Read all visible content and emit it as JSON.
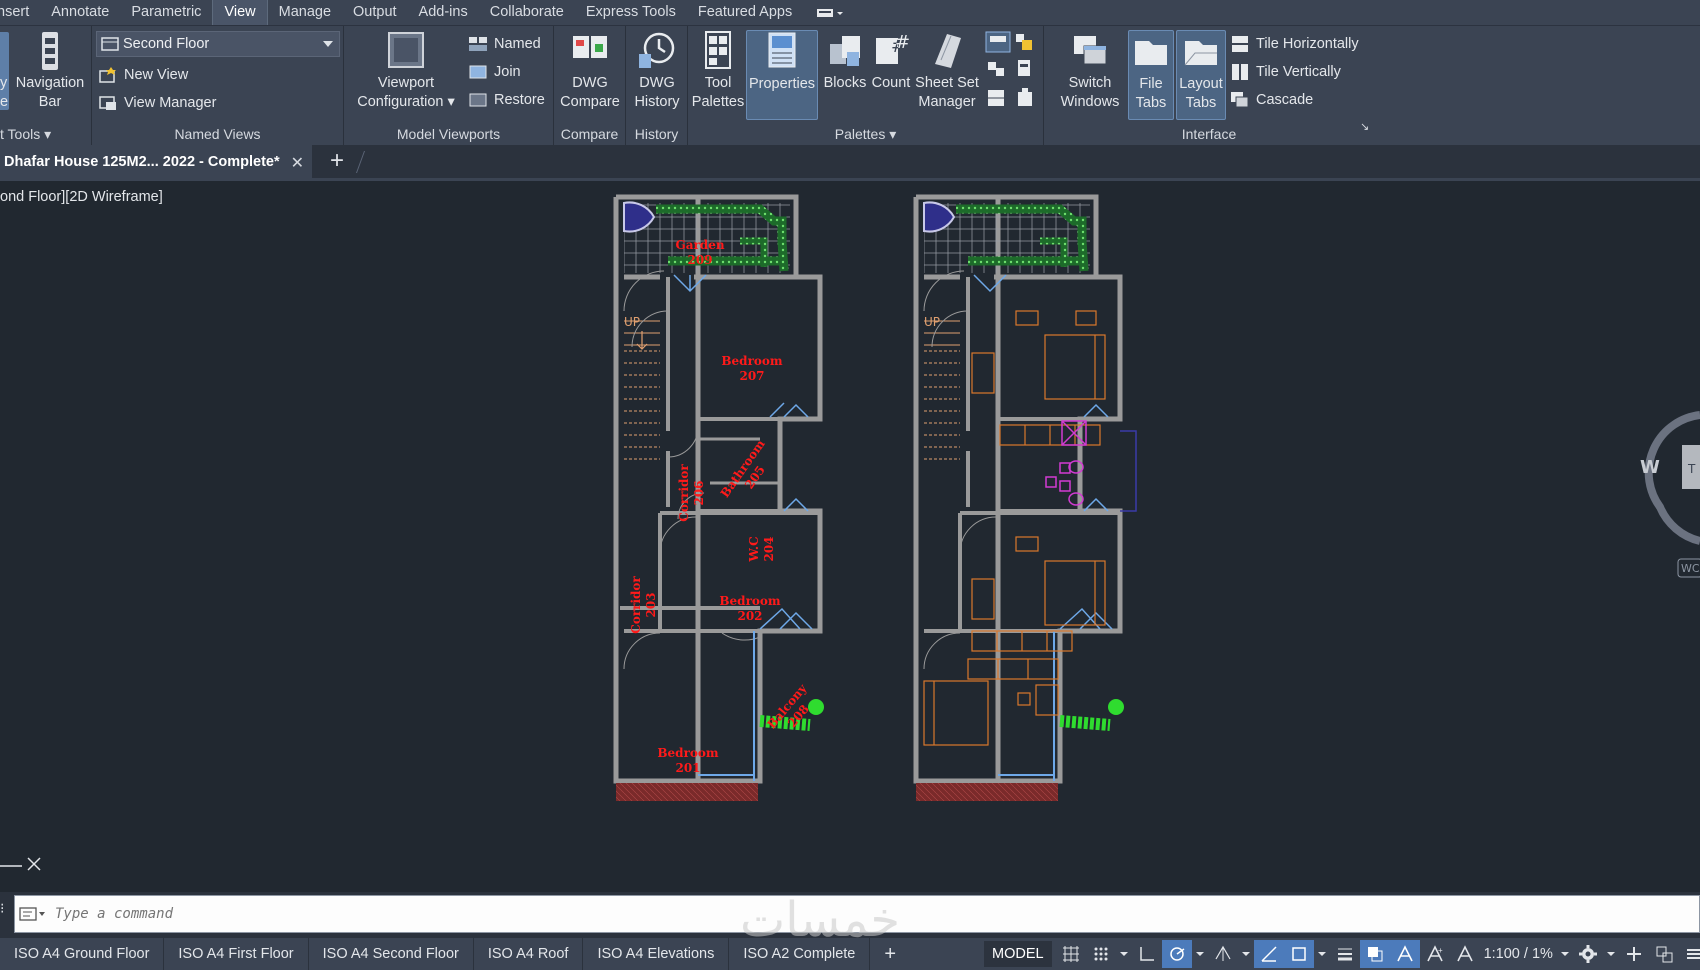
{
  "menu": {
    "items": [
      "Insert",
      "Annotate",
      "Parametric",
      "View",
      "Manage",
      "Output",
      "Add-ins",
      "Collaborate",
      "Express Tools",
      "Featured Apps"
    ],
    "active": "View"
  },
  "ribbon": {
    "navigation_bar": "Navigation Bar",
    "navigation_bar_line1": "Navigation",
    "navigation_bar_line2": "Bar",
    "left_cut_top": "y",
    "left_cut_bottom": "e",
    "viewport_tools_label": "t Tools",
    "named_views": {
      "dropdown_value": "Second Floor",
      "new_view": "New View",
      "view_manager": "View Manager",
      "label": "Named Views"
    },
    "model_viewports": {
      "viewport_configuration_line1": "Viewport",
      "viewport_configuration_line2": "Configuration",
      "named": "Named",
      "join": "Join",
      "restore": "Restore",
      "label": "Model Viewports"
    },
    "compare": {
      "dwg_compare_line1": "DWG",
      "dwg_compare_line2": "Compare",
      "label": "Compare"
    },
    "history": {
      "dwg_history_line1": "DWG",
      "dwg_history_line2": "History",
      "label": "History"
    },
    "palettes": {
      "tool_palettes_line1": "Tool",
      "tool_palettes_line2": "Palettes",
      "properties": "Properties",
      "blocks": "Blocks",
      "count": "Count",
      "sheet_set_manager_line1": "Sheet Set",
      "sheet_set_manager_line2": "Manager",
      "label": "Palettes"
    },
    "interface": {
      "switch_windows_line1": "Switch",
      "switch_windows_line2": "Windows",
      "file_tabs_line1": "File",
      "file_tabs_line2": "Tabs",
      "layout_tabs_line1": "Layout",
      "layout_tabs_line2": "Tabs",
      "tile_horizontally": "Tile Horizontally",
      "tile_vertically": "Tile Vertically",
      "cascade": "Cascade",
      "label": "Interface"
    }
  },
  "tabs": {
    "document": "Dhafar House 125M2... 2022 - Complete*",
    "close": "✕",
    "add": "+"
  },
  "viewport": {
    "label": "ond Floor][2D Wireframe]",
    "compass_w": "W",
    "compass_t": "T",
    "wcs": "WC"
  },
  "plan": {
    "rooms": [
      {
        "name": "Garden",
        "num": "209"
      },
      {
        "name": "Bedroom",
        "num": "207"
      },
      {
        "name": "Corridor",
        "num": "206"
      },
      {
        "name": "Bathroom",
        "num": "205"
      },
      {
        "name": "W.C",
        "num": "204"
      },
      {
        "name": "Corridor",
        "num": "203"
      },
      {
        "name": "Bedroom",
        "num": "202"
      },
      {
        "name": "Balcony",
        "num": "208"
      },
      {
        "name": "Bedroom",
        "num": "201"
      }
    ],
    "up_label": "UP"
  },
  "command": {
    "placeholder": "Type a command"
  },
  "watermark": "خمسات",
  "status": {
    "layouts": [
      "ISO A4 Ground Floor",
      "ISO A4 First Floor",
      "ISO A4 Second Floor",
      "ISO A4 Roof",
      "ISO A4 Elevations",
      "ISO A2 Complete"
    ],
    "add_layout": "+",
    "model": "MODEL",
    "scale": "1:100 / 1%"
  },
  "colors": {
    "accent": "#4c7bbb",
    "room_label": "#ff1a1a",
    "wall": "#9a9a9a",
    "hedge": "#2fdc2f",
    "furniture": "#d9782c",
    "fixture": "#d23bd2",
    "door": "#6ea8e8"
  }
}
